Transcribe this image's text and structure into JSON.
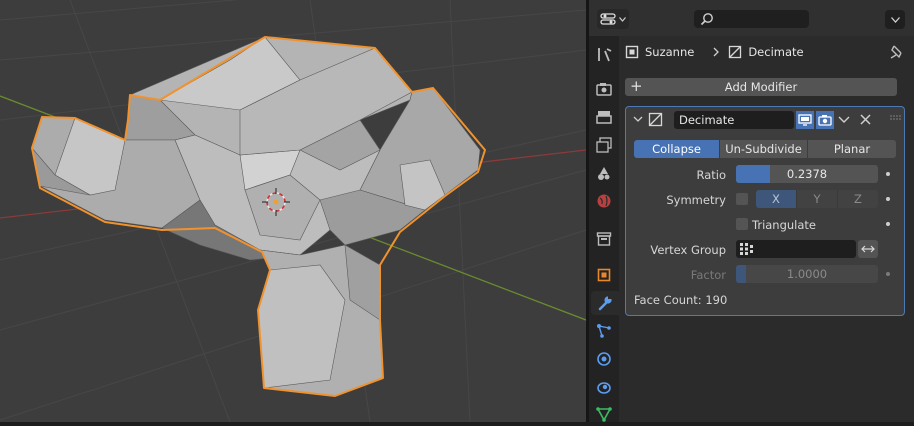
{
  "viewport": {
    "object_name": "Suzanne"
  },
  "header": {
    "editor_type_icon": "properties-editor-icon",
    "search_placeholder": "",
    "menu_icon": "chevron-down-icon"
  },
  "tabs": [
    {
      "name": "tool-icon",
      "active": false
    },
    {
      "name": "render-icon",
      "active": false
    },
    {
      "name": "output-icon",
      "active": false
    },
    {
      "name": "view-layer-icon",
      "active": false
    },
    {
      "name": "scene-icon",
      "active": false
    },
    {
      "name": "world-icon",
      "active": false
    },
    {
      "name": "collection-icon",
      "active": false
    },
    {
      "name": "object-icon",
      "active": false
    },
    {
      "name": "modifier-wrench-icon",
      "active": true
    },
    {
      "name": "particles-icon",
      "active": false
    },
    {
      "name": "physics-icon",
      "active": false
    },
    {
      "name": "constraints-icon",
      "active": false
    },
    {
      "name": "data-icon",
      "active": false
    }
  ],
  "breadcrumb": {
    "object": "Suzanne",
    "modifier": "Decimate"
  },
  "add_modifier_label": "Add Modifier",
  "modifier": {
    "name": "Decimate",
    "modes": [
      "Collapse",
      "Un-Subdivide",
      "Planar"
    ],
    "active_mode": "Collapse",
    "ratio_label": "Ratio",
    "ratio_value": "0.2378",
    "ratio_fraction": 0.2378,
    "symmetry_label": "Symmetry",
    "symmetry_axes": [
      "X",
      "Y",
      "Z"
    ],
    "triangulate_label": "Triangulate",
    "vertex_group_label": "Vertex Group",
    "vertex_group_value": "",
    "factor_label": "Factor",
    "factor_value": "1.0000",
    "factor_fraction": 0.0,
    "face_count": "Face Count: 190"
  },
  "colors": {
    "accent": "#4772b3",
    "selection_outline": "#f0922e",
    "panel": "#3d3d3d"
  }
}
